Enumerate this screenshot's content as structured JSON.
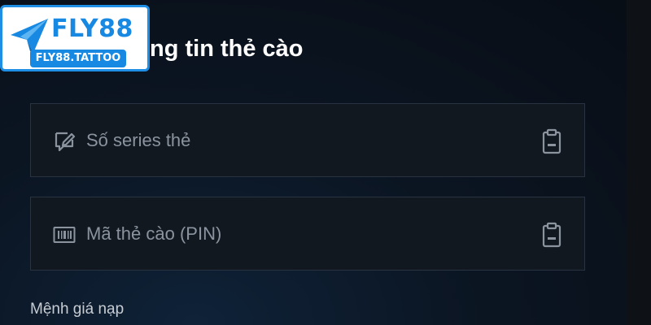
{
  "logo": {
    "brand": "FLY88",
    "domain": "FLY88.TATTOO",
    "icon": "paper-plane-icon",
    "colors": {
      "accent": "#1789e2",
      "border": "#1f8fe6"
    }
  },
  "page": {
    "title": "ng tin thẻ cào"
  },
  "form": {
    "series_field": {
      "placeholder": "Số series thẻ",
      "icon": "edit-note-icon",
      "action_icon": "clipboard-icon"
    },
    "pin_field": {
      "placeholder": "Mã thẻ cào (PIN)",
      "icon": "barcode-icon",
      "action_icon": "clipboard-icon"
    },
    "amount_label": "Mệnh giá nạp"
  }
}
